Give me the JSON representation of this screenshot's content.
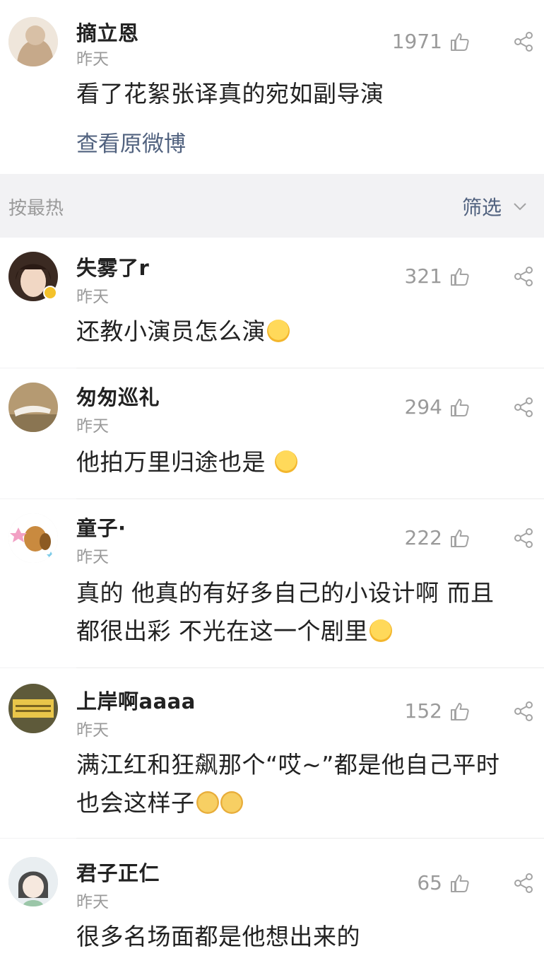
{
  "original": {
    "user": "摘立恩",
    "time": "昨天",
    "likes": "1971",
    "text": "看了花絮张译真的宛如副导演",
    "view_link": "查看原微博"
  },
  "sort": {
    "label": "按最热",
    "filter_label": "筛选"
  },
  "comments": [
    {
      "user": "失雾了r",
      "time": "昨天",
      "likes": "321",
      "lines": [
        "还教小演员怎么演"
      ],
      "emoji": "crying-face"
    },
    {
      "user": "匆匆巡礼",
      "time": "昨天",
      "likes": "294",
      "lines": [
        "他拍万里归途也是 "
      ],
      "emoji": "crying-face"
    },
    {
      "user": "童子·",
      "time": "昨天",
      "likes": "222",
      "lines": [
        "真的 他真的有好多自己的小设计啊 而且",
        "都很出彩 不光在这一个剧里"
      ],
      "emoji": "crying-face"
    },
    {
      "user": "上岸啊aaaa",
      "time": "昨天",
      "likes": "152",
      "lines": [
        "满江红和狂飙那个“哎~”都是他自己平时",
        "也会这样子"
      ],
      "emoji": "cat-face"
    },
    {
      "user": "君子正仁",
      "time": "昨天",
      "likes": "65",
      "lines": [
        "很多名场面都是他想出来的"
      ]
    }
  ]
}
